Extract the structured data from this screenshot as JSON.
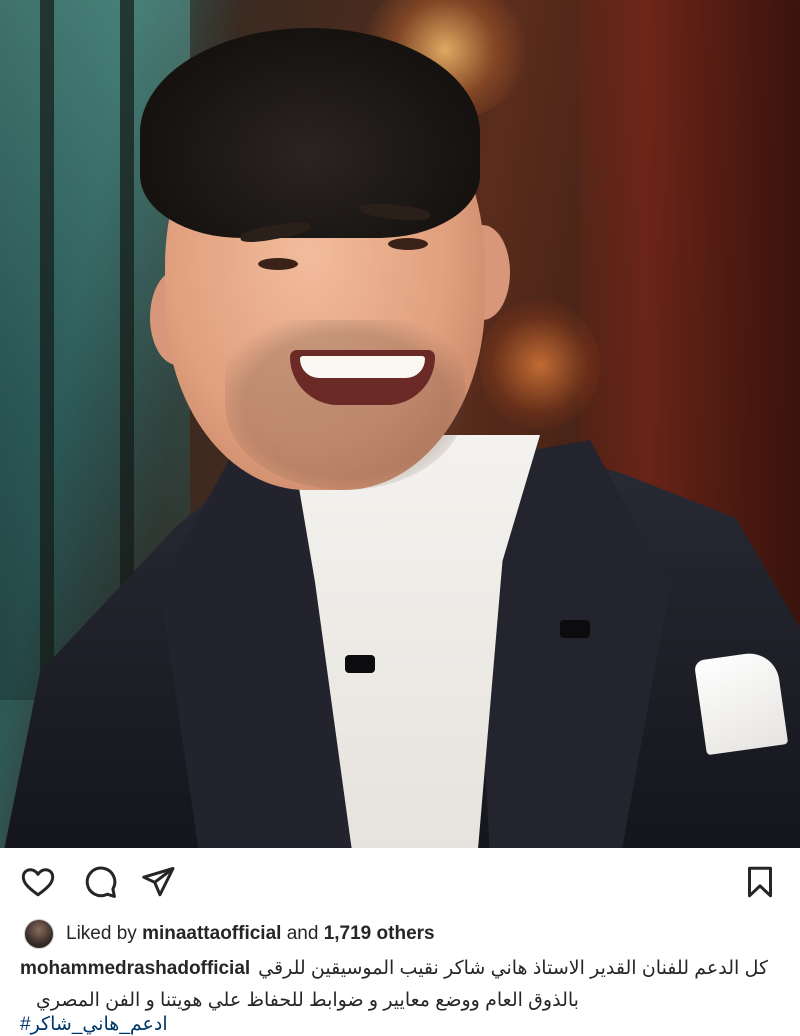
{
  "post": {
    "photo_alt": "",
    "actions": {
      "like_icon": "heart-outline-icon",
      "comment_icon": "comment-bubble-icon",
      "share_icon": "paper-plane-icon",
      "save_icon": "bookmark-outline-icon"
    },
    "likes": {
      "prefix": "Liked by",
      "user": "minaattaofficial",
      "middle": "and",
      "count_text": "1,719 others"
    },
    "caption": {
      "username": "mohammedrashadofficial",
      "line1": "كل الدعم للفنان القدير  الاستاذ هاني شاكر نقيب الموسيقين للرقي",
      "line2": "بالذوق العام ووضع معايير و ضوابط للحفاظ علي هويتنا و الفن المصري",
      "hashtag": "#ادعم_هاني_شاكر"
    }
  },
  "colors": {
    "text": "#262626",
    "hashtag": "#00376b",
    "background": "#ffffff"
  }
}
